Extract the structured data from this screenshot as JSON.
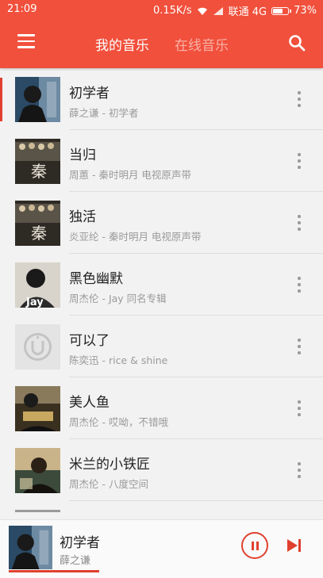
{
  "status_bar": {
    "time": "21:09",
    "speed": "0.15K/s",
    "carrier": "联通 4G",
    "battery": "73%",
    "battery_level": 0.73
  },
  "header": {
    "tabs": [
      {
        "label": "我的音乐",
        "active": true
      },
      {
        "label": "在线音乐",
        "active": false
      }
    ],
    "menu_icon": "hamburger-menu-icon",
    "search_icon": "search-icon",
    "background_color": "#f1503c"
  },
  "songs": [
    {
      "title": "初学者",
      "subtitle": "薛之谦 - 初学者",
      "selected": true
    },
    {
      "title": "当归",
      "subtitle": "周蕙 - 秦时明月 电视原声带",
      "selected": false
    },
    {
      "title": "独活",
      "subtitle": "炎亚纶 - 秦时明月 电视原声带",
      "selected": false
    },
    {
      "title": "黑色幽默",
      "subtitle": "周杰伦 - Jay 同名专辑",
      "selected": false
    },
    {
      "title": "可以了",
      "subtitle": "陈奕迅 - rice & shine",
      "selected": false
    },
    {
      "title": "美人鱼",
      "subtitle": "周杰伦 - 哎呦，不错哦",
      "selected": false
    },
    {
      "title": "米兰的小铁匠",
      "subtitle": "周杰伦 - 八度空间",
      "selected": false
    },
    {
      "title": "",
      "subtitle": "",
      "selected": false
    }
  ],
  "covers": {
    "jay_album_text": "Jay",
    "qin_album_text": "秦"
  },
  "player": {
    "title": "初学者",
    "artist": "薛之谦",
    "progress": 0.28,
    "pause_icon": "pause-icon",
    "next_icon": "skip-next-icon"
  },
  "accent_color": "#e0402e"
}
